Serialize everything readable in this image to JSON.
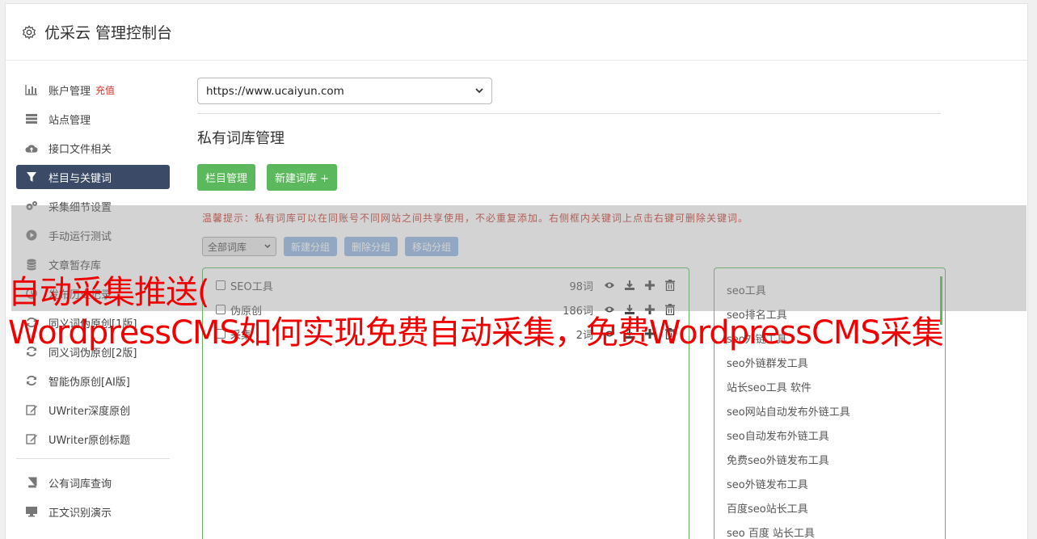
{
  "header": {
    "title": "优采云 管理控制台",
    "icon": "gear-icon"
  },
  "sidebar": {
    "items": [
      {
        "label": "账户管理",
        "badge": "充值",
        "icon": "bar-chart-icon"
      },
      {
        "label": "站点管理",
        "icon": "server-icon"
      },
      {
        "label": "接口文件相关",
        "icon": "cloud-upload-icon"
      },
      {
        "label": "栏目与关键词",
        "icon": "filter-icon",
        "active": true
      },
      {
        "label": "采集细节设置",
        "icon": "cogs-icon"
      },
      {
        "label": "手动运行测试",
        "icon": "play-circle-icon"
      },
      {
        "label": "文章暂存库",
        "icon": "database-icon"
      },
      {
        "label": "发布历史记录",
        "icon": "history-icon"
      },
      {
        "label": "同义词伪原创[1版]",
        "icon": "refresh-icon"
      },
      {
        "label": "同义词伪原创[2版]",
        "icon": "refresh-icon"
      },
      {
        "label": "智能伪原创[AI版]",
        "icon": "refresh-icon"
      },
      {
        "label": "UWriter深度原创",
        "icon": "edit-icon"
      },
      {
        "label": "UWriter原创标题",
        "icon": "edit-icon"
      }
    ],
    "items2": [
      {
        "label": "公有词库查询",
        "icon": "book-icon"
      },
      {
        "label": "正文识别演示",
        "icon": "monitor-icon"
      }
    ]
  },
  "main": {
    "site_select": "https://www.ucaiyun.com",
    "section_title": "私有词库管理",
    "btn_columns": "栏目管理",
    "btn_new_lib": "新建词库 +",
    "tip": "温馨提示：私有词库可以在同账号不同网站之间共享使用，不必重复添加。右侧框内关键词上点击右键可删除关键词。",
    "filter_select": "全部词库",
    "btn_new_group": "新建分组",
    "btn_del_group": "删除分组",
    "btn_move_group": "移动分组",
    "libraries": [
      {
        "name": "SEO工具",
        "count": "98词"
      },
      {
        "name": "伪原创",
        "count": "186词"
      },
      {
        "name": "采集",
        "count": "2词"
      }
    ],
    "keywords": [
      "seo工具",
      "seo排名工具",
      "seo外链工具",
      "seo外链群发工具",
      "站长seo工具 软件",
      "seo网站自动发布外链工具",
      "seo自动发布外链工具",
      "免费seo外链发布工具",
      "seo外链发布工具",
      "百度seo站长工具",
      "seo 百度 站长工具"
    ]
  },
  "overlay": {
    "line1": "自动采集推送(",
    "line2": "WordpressCMS如何实现免费自动采集，免费WordpressCMS采集"
  },
  "colors": {
    "nav_active": "#3b4a67",
    "green": "#5cb85c",
    "blue_btn": "#8fb4e0",
    "overlay_text": "#f00000",
    "tip": "#c0392b"
  }
}
